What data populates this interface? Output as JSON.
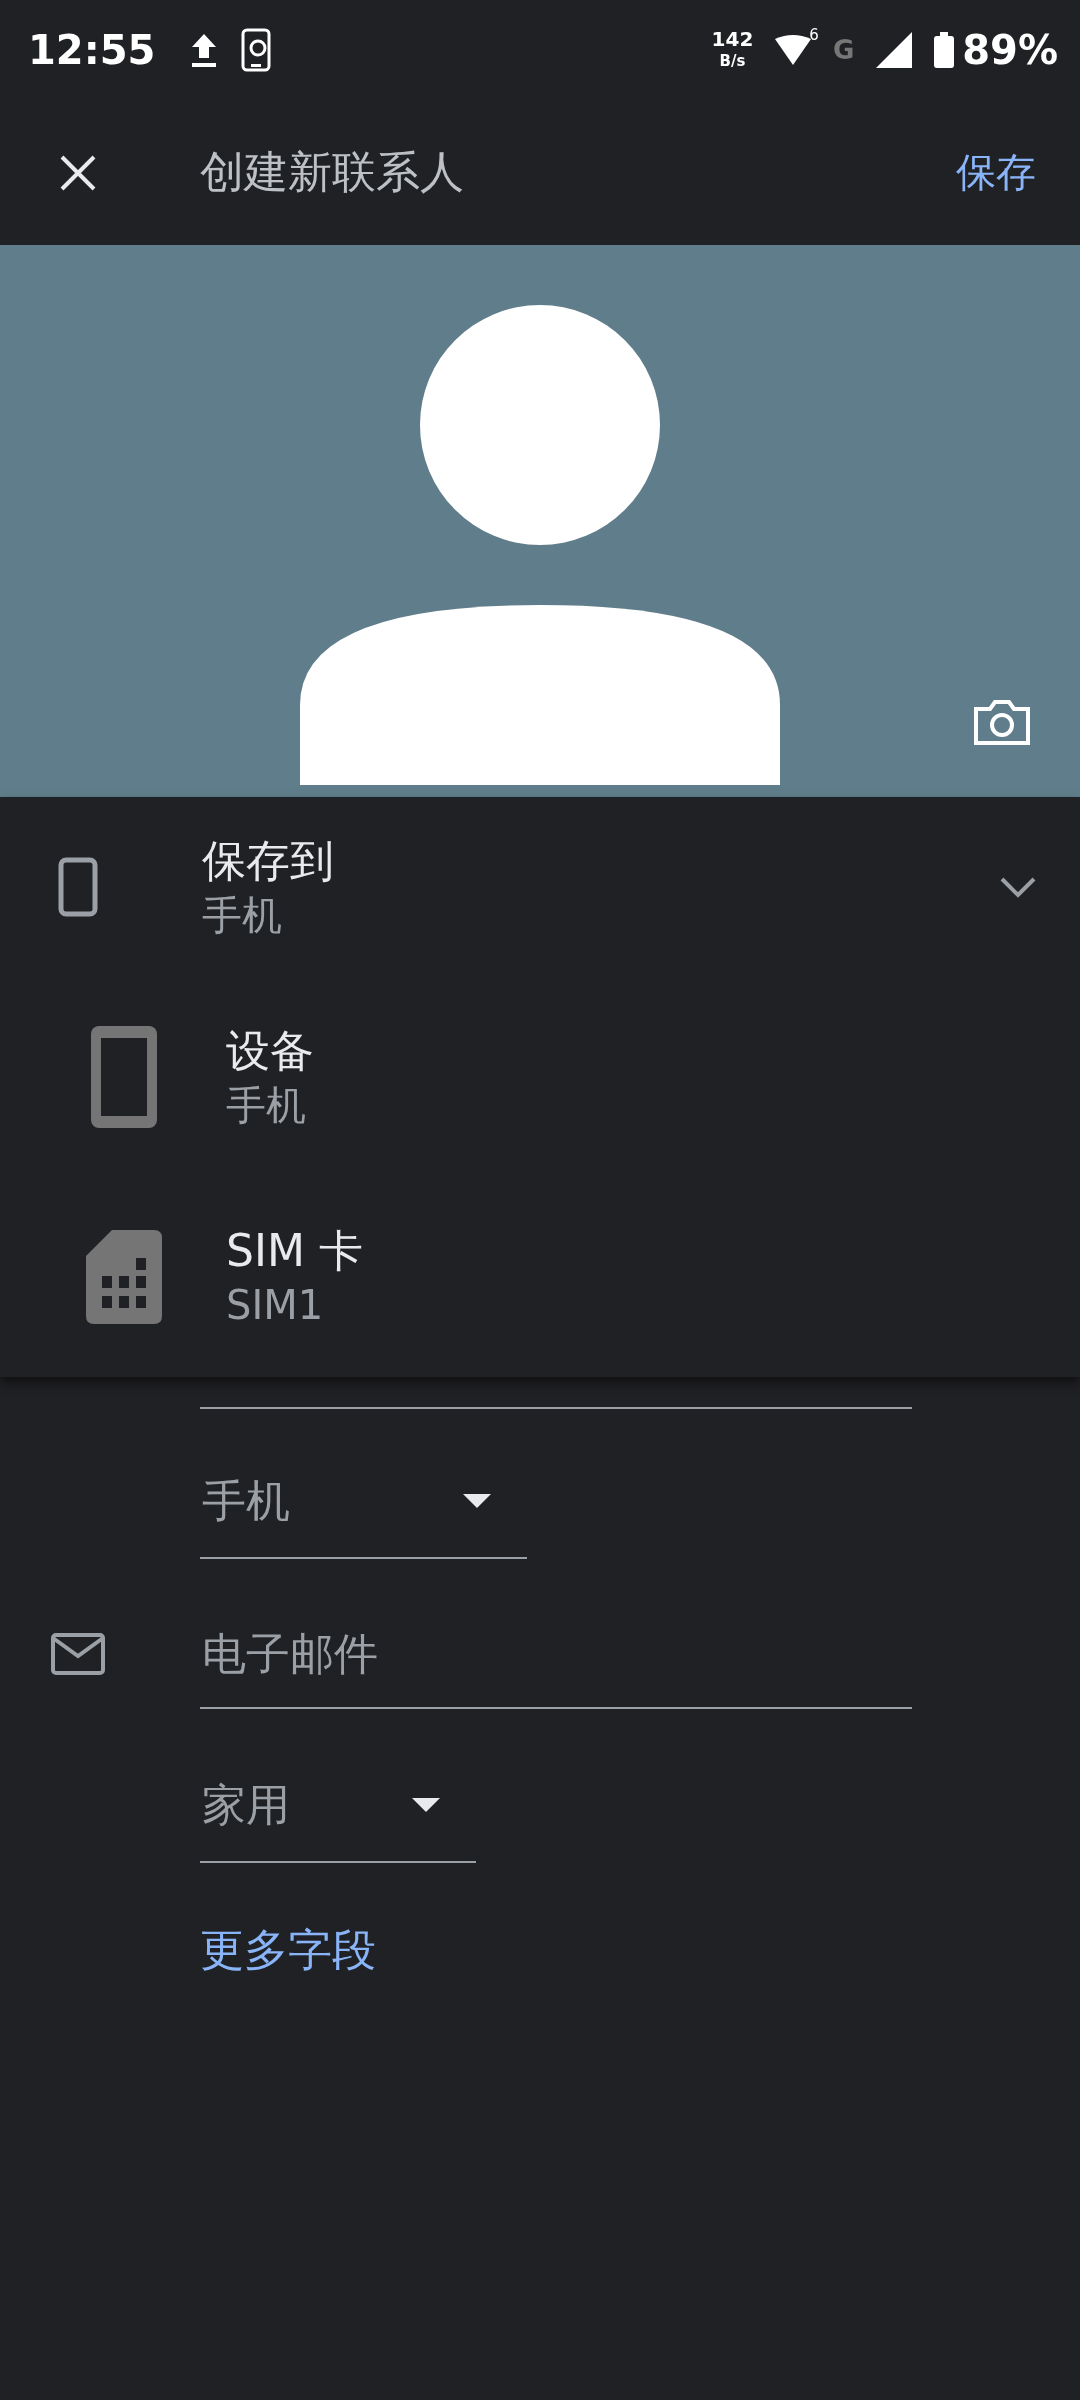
{
  "status_bar": {
    "time": "12:55",
    "speed_value": "142",
    "speed_unit": "B/s",
    "wifi_badge": "6",
    "network_type": "G",
    "battery": "89%"
  },
  "app_bar": {
    "title": "创建新联系人",
    "save_button": "保存"
  },
  "save_to": {
    "label": "保存到",
    "value": "手机"
  },
  "account_menu": [
    {
      "kind": "device",
      "title": "设备",
      "subtitle": "手机"
    },
    {
      "kind": "sim",
      "title": "SIM 卡",
      "subtitle": "SIM1"
    }
  ],
  "form": {
    "phone_type": "手机",
    "email": {
      "placeholder": "电子邮件"
    },
    "email_type": "家用",
    "more_fields": "更多字段"
  }
}
